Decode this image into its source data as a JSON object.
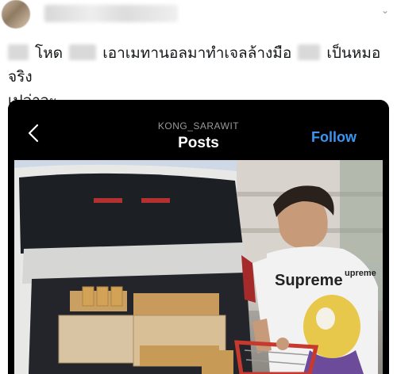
{
  "tweet": {
    "text_line1": "โหด",
    "text_line1_b": "เอาเมทานอลมาทำเจลล้างมือ",
    "text_line1_c": "เป็นหมอจริง",
    "text_line2": "เปล่าวะ"
  },
  "instagram": {
    "username": "KONG_SARAWIT",
    "title": "Posts",
    "follow_label": "Follow"
  },
  "photo": {
    "shirt_text": "Supreme",
    "sleeve_text": "upreme"
  },
  "colors": {
    "follow": "#3b95f2",
    "ig_background": "#000000",
    "text": "#14171a"
  }
}
